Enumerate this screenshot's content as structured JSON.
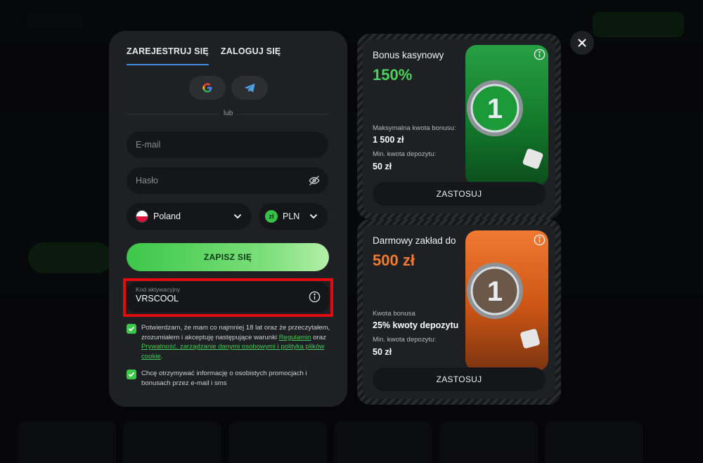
{
  "tabs": [
    {
      "label": "ZAREJESTRUJ SIĘ"
    },
    {
      "label": "ZALOGUJ SIĘ"
    }
  ],
  "social": [
    {
      "icon": "google-icon"
    },
    {
      "icon": "telegram-icon"
    }
  ],
  "divider_text": "lub",
  "form": {
    "email_placeholder": "E-mail",
    "password_placeholder": "Hasło",
    "country": "Poland",
    "currency": "PLN",
    "currency_symbol": "zł",
    "submit_label": "ZAPISZ SIĘ",
    "promo_label": "Kod aktywacyjny",
    "promo_value": "VRSCOOL"
  },
  "consent": {
    "terms_text_1": "Potwierdzam, że mam co najmniej 18 lat oraz że przeczytałem, zrozumiałem i akceptuję następujące warunki ",
    "terms_link_1": "Regulamin",
    "terms_and": " oraz ",
    "terms_link_2": "Prywatność, zarządzanie danymi osobowymi i polityka plików cookie",
    "terms_end": ".",
    "marketing_text": "Chcę otrzymywać informację o osobistych promocjach i bonusach przez e-mail i sms"
  },
  "bonus_cards": [
    {
      "title": "Bonus kasynowy",
      "amount": "150%",
      "detail1_label": "Maksymalna kwota bonusu:",
      "detail1_value": "1 500 zł",
      "detail2_label": "Min. kwota depozytu:",
      "detail2_value": "50 zł",
      "apply_label": "ZASTOSUJ"
    },
    {
      "title": "Darmowy zakład do",
      "amount": "500 zł",
      "detail1_label": "Kwota bonusa",
      "detail1_value": "25% kwoty depozytu",
      "detail2_label": "Min. kwota depozytu:",
      "detail2_value": "50 zł",
      "apply_label": "ZASTOSUJ"
    }
  ],
  "colors": {
    "accent_green": "#3cc74a",
    "accent_orange": "#f27c30",
    "highlight_red": "#e20b10",
    "tab_underline": "#3f8ce0"
  }
}
